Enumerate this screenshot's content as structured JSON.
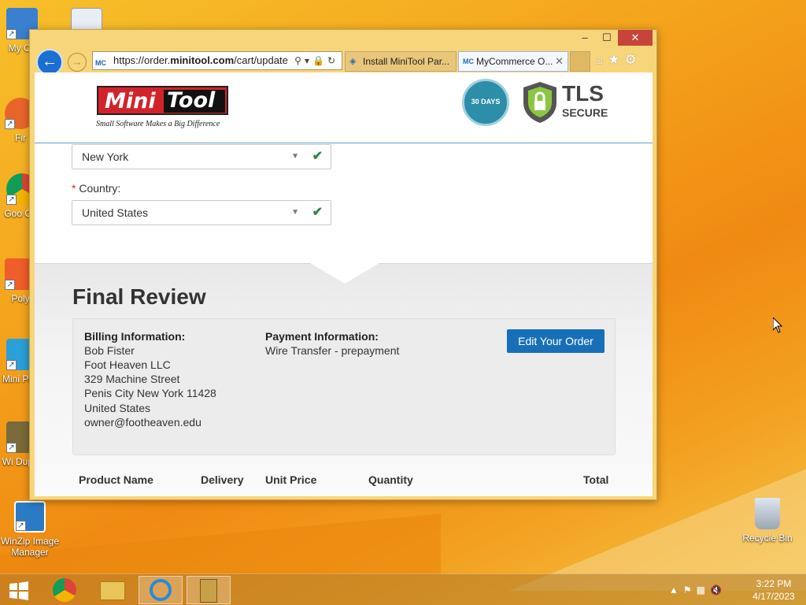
{
  "desktop": {
    "icons": [
      {
        "label": "My Co",
        "icon": "computer-icon"
      },
      {
        "label": "Fir",
        "icon": "firefox-icon"
      },
      {
        "label": "Goo Chr",
        "icon": "chrome-icon"
      },
      {
        "label": "Poly",
        "icon": "app-icon"
      },
      {
        "label": "Mini Parti",
        "icon": "minitool-partition-icon"
      },
      {
        "label": "Wi Duplic",
        "icon": "duplicate-finder-icon"
      },
      {
        "label": "WinZip Image Manager",
        "icon": "winzip-image-icon"
      },
      {
        "label": "Recycle Bin",
        "icon": "recycle-bin-icon"
      }
    ]
  },
  "browser": {
    "caption": {
      "minimize": "–",
      "maximize": "☐",
      "close": "✕"
    },
    "address_bar": {
      "url_prefix": "https://order.",
      "url_domain": "minitool.com",
      "url_rest": "/cart/update?c"
    },
    "tabs": [
      {
        "label": "Install MiniTool Par...",
        "active": false
      },
      {
        "label": "MyCommerce O...",
        "active": true
      }
    ]
  },
  "site": {
    "logo_mini": "Mini",
    "logo_tool": "Tool",
    "tagline": "Small Software Makes a Big Difference",
    "return_badge": "30 DAYS",
    "tls_title": "TLS",
    "tls_subtitle": "SECURE"
  },
  "form": {
    "state_value": "New York",
    "country_label": "Country:",
    "country_value": "United States"
  },
  "review": {
    "title": "Final Review",
    "billing_title": "Billing Information:",
    "billing_lines": [
      "Bob Fister",
      "Foot Heaven LLC",
      "329 Machine Street",
      "Penis City New York 11428",
      "United States",
      "owner@footheaven.edu"
    ],
    "payment_title": "Payment Information:",
    "payment_method": "Wire Transfer - prepayment",
    "edit_button": "Edit Your Order"
  },
  "table": {
    "headers": [
      "Product Name",
      "Delivery",
      "Unit Price",
      "Quantity",
      "Total"
    ]
  },
  "taskbar": {
    "time": "3:22 PM",
    "date": "4/17/2023"
  }
}
